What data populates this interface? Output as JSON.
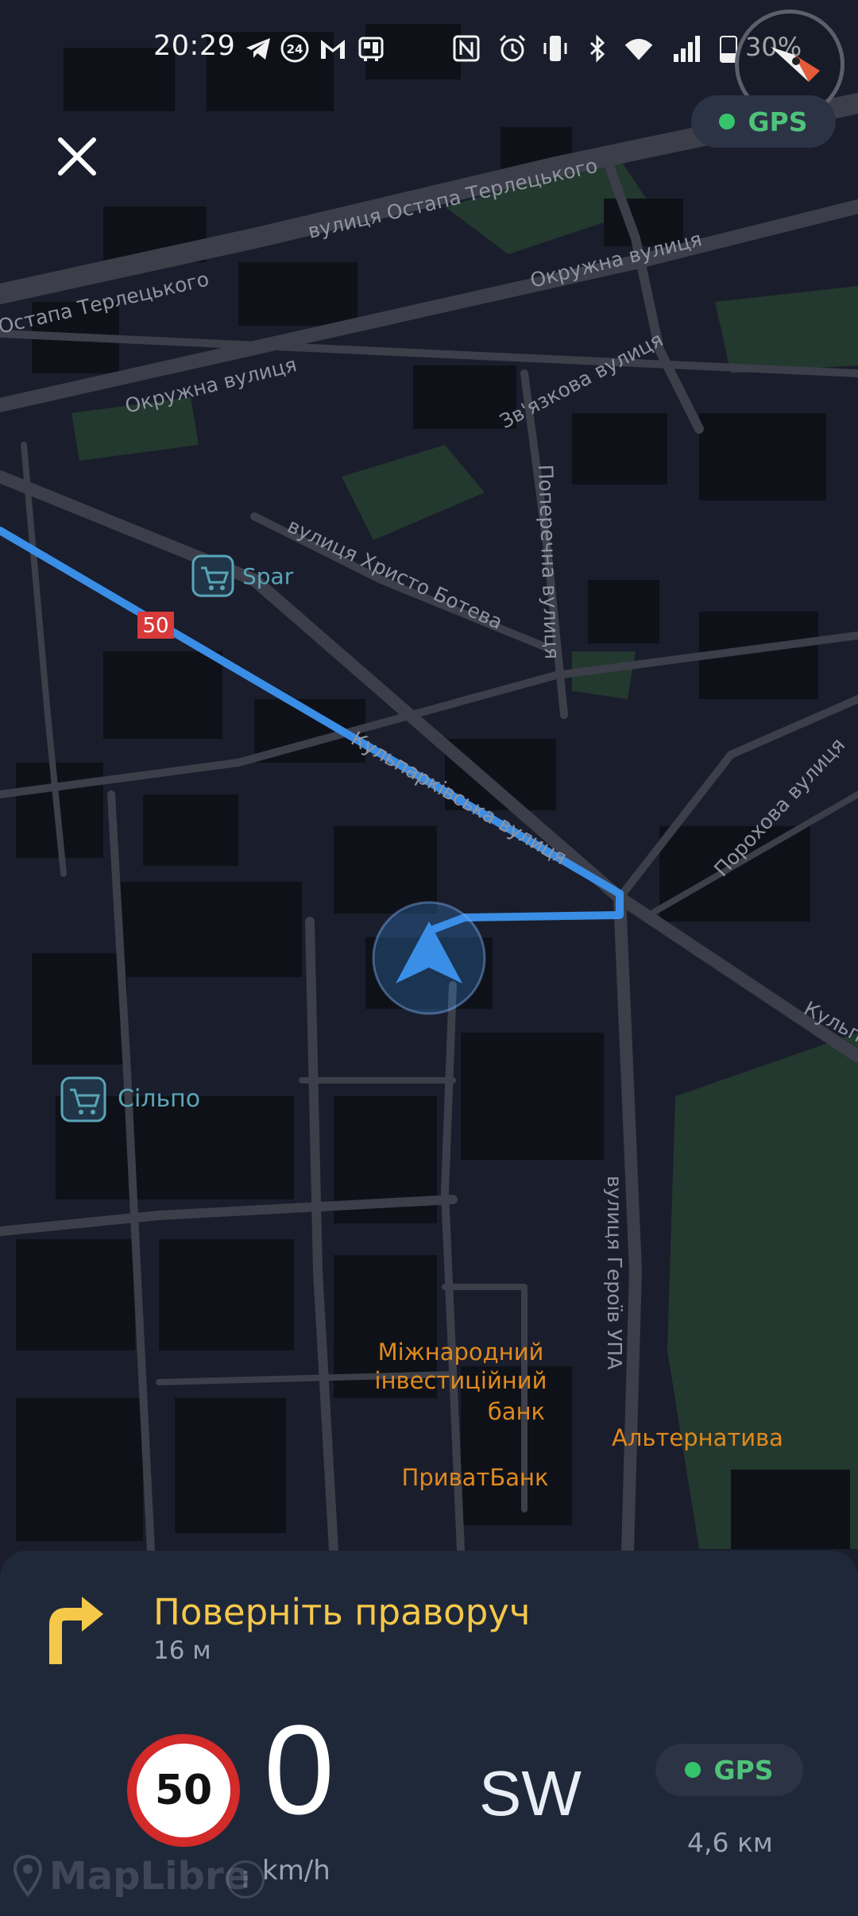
{
  "status_bar": {
    "time": "20:29",
    "notification_icons": [
      "telegram-icon",
      "24-channel-icon",
      "gmail-icon",
      "bus-app-icon"
    ],
    "system_icons": [
      "nfc-icon",
      "alarm-icon",
      "vibrate-icon",
      "bluetooth-icon",
      "wifi-icon",
      "signal-icon",
      "battery-icon"
    ],
    "battery_percent": "30%"
  },
  "top": {
    "gps_label": "GPS"
  },
  "map": {
    "streets": {
      "terletskoho_top": "вулиця Остапа Терлецького",
      "terletskoho_left": "Остапа Терлецького",
      "okruzhna_right": "Окружна вулиця",
      "okruzhna_left": "Окружна вулиця",
      "zviazkova": "Зв'язкова вулиця",
      "poperechna": "Поперечна вулиця",
      "khrysto_boteva": "вулиця Христо Ботева",
      "kulparkivska": "Кульпарківська вулиця",
      "kulparkivska_right": "Кульп",
      "porokhova": "Порохова вулиця",
      "heroiv_upa": "вулиця Героїв УПА"
    },
    "pois": {
      "spar": "Spar",
      "silpo": "Сільпо",
      "mib_line1": "Міжнародний",
      "mib_line2": "інвестиційний",
      "mib_line3": "банк",
      "alternatyva": "Альтернатива",
      "privatbank": "ПриватБанк"
    },
    "road_speed_badge": "50",
    "colors": {
      "route": "#3a8ee6",
      "background": "#1a1d2c",
      "poi_orange": "#e08a1e",
      "poi_teal": "#5aa5b8"
    }
  },
  "navigation": {
    "instruction": "Поверніть праворуч",
    "distance_to_turn": "16 м",
    "speed_limit": "50",
    "current_speed": "0",
    "speed_unit": "km/h",
    "heading": "SW",
    "gps_label": "GPS",
    "remaining_distance": "4,6 км"
  },
  "attribution": {
    "logo_text": "MapLibre",
    "info_label": "i"
  }
}
